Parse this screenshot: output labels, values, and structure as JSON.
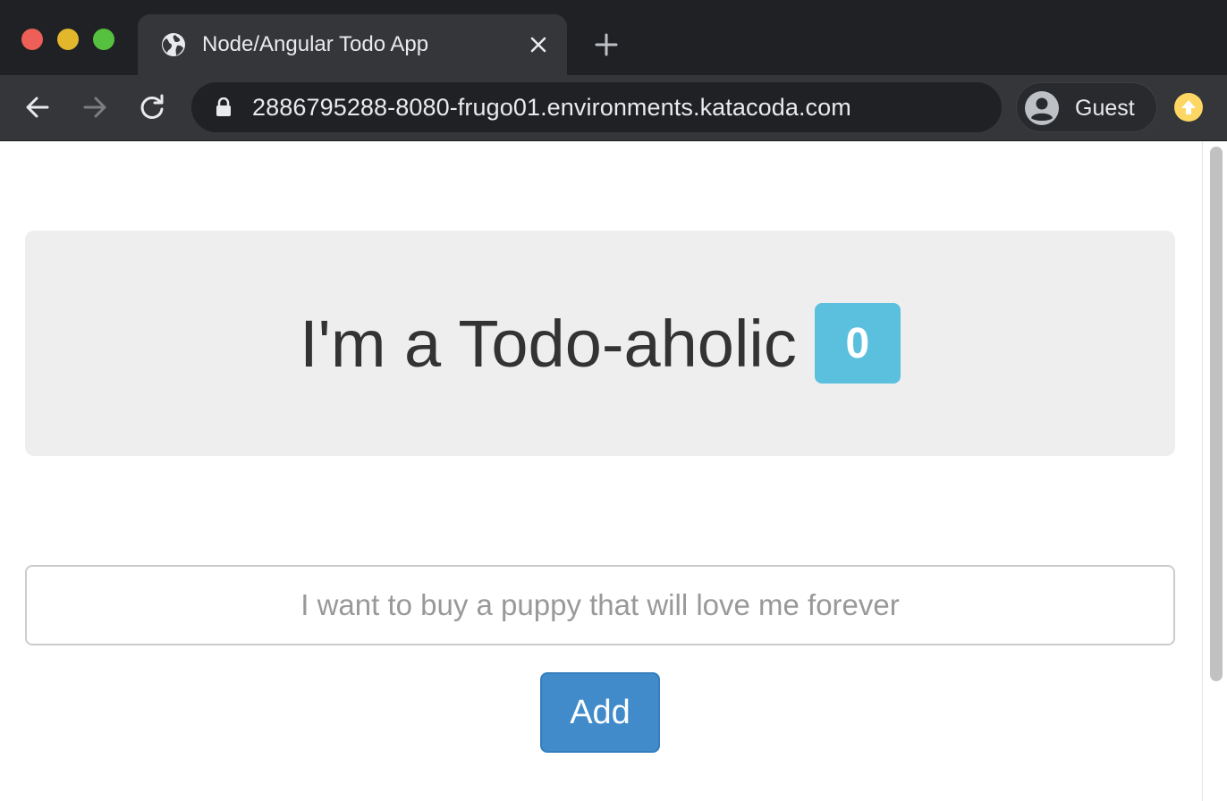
{
  "browser": {
    "tab": {
      "title": "Node/Angular Todo App",
      "favicon": "globe-icon"
    },
    "address_bar": {
      "url": "2886795288-8080-frugo01.environments.katacoda.com"
    },
    "profile": {
      "label": "Guest"
    },
    "colors": {
      "frame": "#202124",
      "toolbar": "#35363a",
      "update": "#fdd663"
    }
  },
  "app": {
    "heading": "I'm a Todo-aholic",
    "todo_count": "0",
    "input": {
      "value": "",
      "placeholder": "I want to buy a puppy that will love me forever"
    },
    "add_label": "Add",
    "colors": {
      "badge": "#5bc0de",
      "button": "#428bca",
      "jumbotron": "#eeeeee"
    }
  }
}
